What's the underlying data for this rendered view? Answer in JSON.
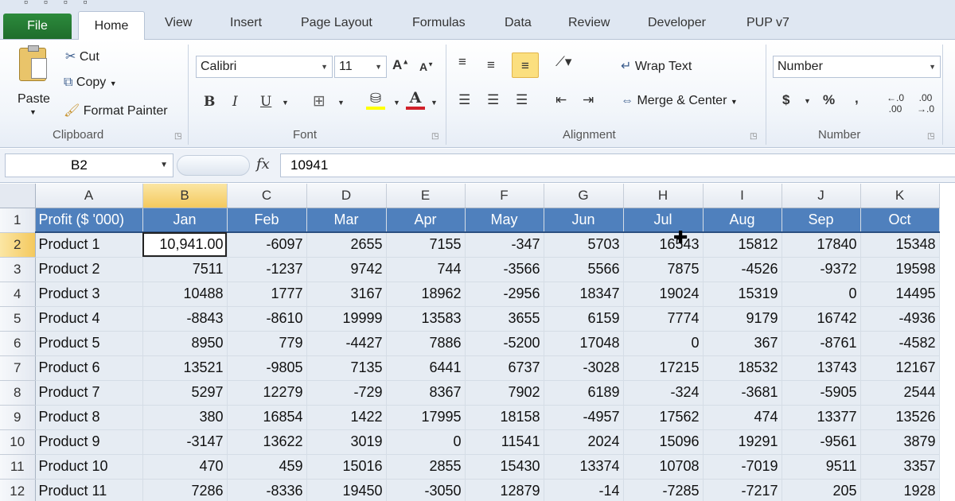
{
  "tabs": [
    "File",
    "Home",
    "View",
    "Insert",
    "Page Layout",
    "Formulas",
    "Data",
    "Review",
    "Developer",
    "PUP v7"
  ],
  "clipboard": {
    "paste_label": "Paste",
    "cut_label": "Cut",
    "copy_label": "Copy",
    "format_painter_label": "Format Painter",
    "group_label": "Clipboard"
  },
  "font": {
    "font_name": "Calibri",
    "font_size": "11",
    "group_label": "Font"
  },
  "alignment": {
    "wrap_text_label": "Wrap Text",
    "merge_center_label": "Merge & Center",
    "group_label": "Alignment"
  },
  "number": {
    "format_value": "Number",
    "group_label": "Number",
    "currency_symbol": "$",
    "percent_symbol": "%",
    "comma_symbol": ","
  },
  "formula_bar": {
    "name_box": "B2",
    "fx": "fx",
    "formula": "10941"
  },
  "grid": {
    "columns": [
      "A",
      "B",
      "C",
      "D",
      "E",
      "F",
      "G",
      "H",
      "I",
      "J",
      "K"
    ],
    "selected_column": "B",
    "selected_row": "2",
    "rows": [
      {
        "n": "1",
        "cells": [
          "Profit ($ '000)",
          "Jan",
          "Feb",
          "Mar",
          "Apr",
          "May",
          "Jun",
          "Jul",
          "Aug",
          "Sep",
          "Oct"
        ]
      },
      {
        "n": "2",
        "cells": [
          "Product 1",
          "10,941.00",
          "-6097",
          "2655",
          "7155",
          "-347",
          "5703",
          "16543",
          "15812",
          "17840",
          "15348"
        ]
      },
      {
        "n": "3",
        "cells": [
          "Product 2",
          "7511",
          "-1237",
          "9742",
          "744",
          "-3566",
          "5566",
          "7875",
          "-4526",
          "-9372",
          "19598"
        ]
      },
      {
        "n": "4",
        "cells": [
          "Product 3",
          "10488",
          "1777",
          "3167",
          "18962",
          "-2956",
          "18347",
          "19024",
          "15319",
          "0",
          "14495"
        ]
      },
      {
        "n": "5",
        "cells": [
          "Product 4",
          "-8843",
          "-8610",
          "19999",
          "13583",
          "3655",
          "6159",
          "7774",
          "9179",
          "16742",
          "-4936"
        ]
      },
      {
        "n": "6",
        "cells": [
          "Product 5",
          "8950",
          "779",
          "-4427",
          "7886",
          "-5200",
          "17048",
          "0",
          "367",
          "-8761",
          "-4582"
        ]
      },
      {
        "n": "7",
        "cells": [
          "Product 6",
          "13521",
          "-9805",
          "7135",
          "6441",
          "6737",
          "-3028",
          "17215",
          "18532",
          "13743",
          "12167"
        ]
      },
      {
        "n": "8",
        "cells": [
          "Product 7",
          "5297",
          "12279",
          "-729",
          "8367",
          "7902",
          "6189",
          "-324",
          "-3681",
          "-5905",
          "2544"
        ]
      },
      {
        "n": "9",
        "cells": [
          "Product 8",
          "380",
          "16854",
          "1422",
          "17995",
          "18158",
          "-4957",
          "17562",
          "474",
          "13377",
          "13526"
        ]
      },
      {
        "n": "10",
        "cells": [
          "Product 9",
          "-3147",
          "13622",
          "3019",
          "0",
          "11541",
          "2024",
          "15096",
          "19291",
          "-9561",
          "3879"
        ]
      },
      {
        "n": "11",
        "cells": [
          "Product 10",
          "470",
          "459",
          "15016",
          "2855",
          "15430",
          "13374",
          "10708",
          "-7019",
          "9511",
          "3357"
        ]
      },
      {
        "n": "12",
        "cells": [
          "Product 11",
          "7286",
          "-8336",
          "19450",
          "-3050",
          "12879",
          "-14",
          "-7285",
          "-7217",
          "205",
          "1928"
        ]
      }
    ]
  }
}
